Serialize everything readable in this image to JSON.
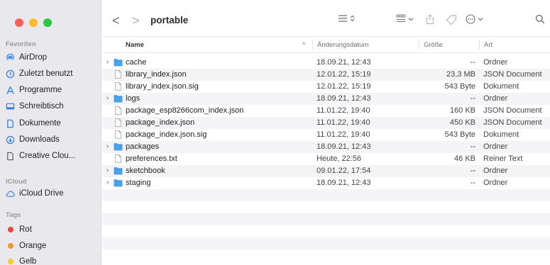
{
  "window": {
    "title": "portable"
  },
  "colors": {
    "close": "#ff5f57",
    "minimize": "#febc2e",
    "maximize": "#28c840",
    "folder": "#4aa3e8",
    "accent": "#2f7cf6"
  },
  "sidebar": {
    "favorites_title": "Favoriten",
    "favorites": [
      {
        "label": "AirDrop",
        "icon": "airdrop-icon"
      },
      {
        "label": "Zuletzt benutzt",
        "icon": "clock-icon"
      },
      {
        "label": "Programme",
        "icon": "apps-icon"
      },
      {
        "label": "Schreibtisch",
        "icon": "desktop-icon"
      },
      {
        "label": "Dokumente",
        "icon": "document-icon"
      },
      {
        "label": "Downloads",
        "icon": "download-icon"
      },
      {
        "label": "Creative Clou...",
        "icon": "file-icon"
      }
    ],
    "icloud_title": "iCloud",
    "icloud": [
      {
        "label": "iCloud Drive",
        "icon": "cloud-icon"
      }
    ],
    "tags_title": "Tags",
    "tags": [
      {
        "label": "Rot",
        "color": "#f2433a"
      },
      {
        "label": "Orange",
        "color": "#f7982a"
      },
      {
        "label": "Gelb",
        "color": "#f7cd2a"
      }
    ]
  },
  "toolbar": {
    "back": "<",
    "forward": ">"
  },
  "columns": {
    "name": "Name",
    "date": "Änderungsdatum",
    "size": "Größe",
    "kind": "Art"
  },
  "files": [
    {
      "name": "cache",
      "date": "18.09.21, 12:43",
      "size": "--",
      "kind": "Ordner",
      "folder": true
    },
    {
      "name": "library_index.json",
      "date": "12.01.22, 15:19",
      "size": "23,3 MB",
      "kind": "JSON Document",
      "folder": false
    },
    {
      "name": "library_index.json.sig",
      "date": "12.01.22, 15:19",
      "size": "543 Byte",
      "kind": "Dokument",
      "folder": false
    },
    {
      "name": "logs",
      "date": "18.09.21, 12:43",
      "size": "--",
      "kind": "Ordner",
      "folder": true
    },
    {
      "name": "package_esp8266com_index.json",
      "date": "11.01.22, 19:40",
      "size": "160 KB",
      "kind": "JSON Document",
      "folder": false
    },
    {
      "name": "package_index.json",
      "date": "11.01.22, 19:40",
      "size": "450 KB",
      "kind": "JSON Document",
      "folder": false
    },
    {
      "name": "package_index.json.sig",
      "date": "11.01.22, 19:40",
      "size": "543 Byte",
      "kind": "Dokument",
      "folder": false
    },
    {
      "name": "packages",
      "date": "18.09.21, 12:43",
      "size": "--",
      "kind": "Ordner",
      "folder": true
    },
    {
      "name": "preferences.txt",
      "date": "Heute, 22:56",
      "size": "46 KB",
      "kind": "Reiner Text",
      "folder": false
    },
    {
      "name": "sketchbook",
      "date": "09.01.22, 17:54",
      "size": "--",
      "kind": "Ordner",
      "folder": true
    },
    {
      "name": "staging",
      "date": "18.09.21, 12:43",
      "size": "--",
      "kind": "Ordner",
      "folder": true
    }
  ]
}
